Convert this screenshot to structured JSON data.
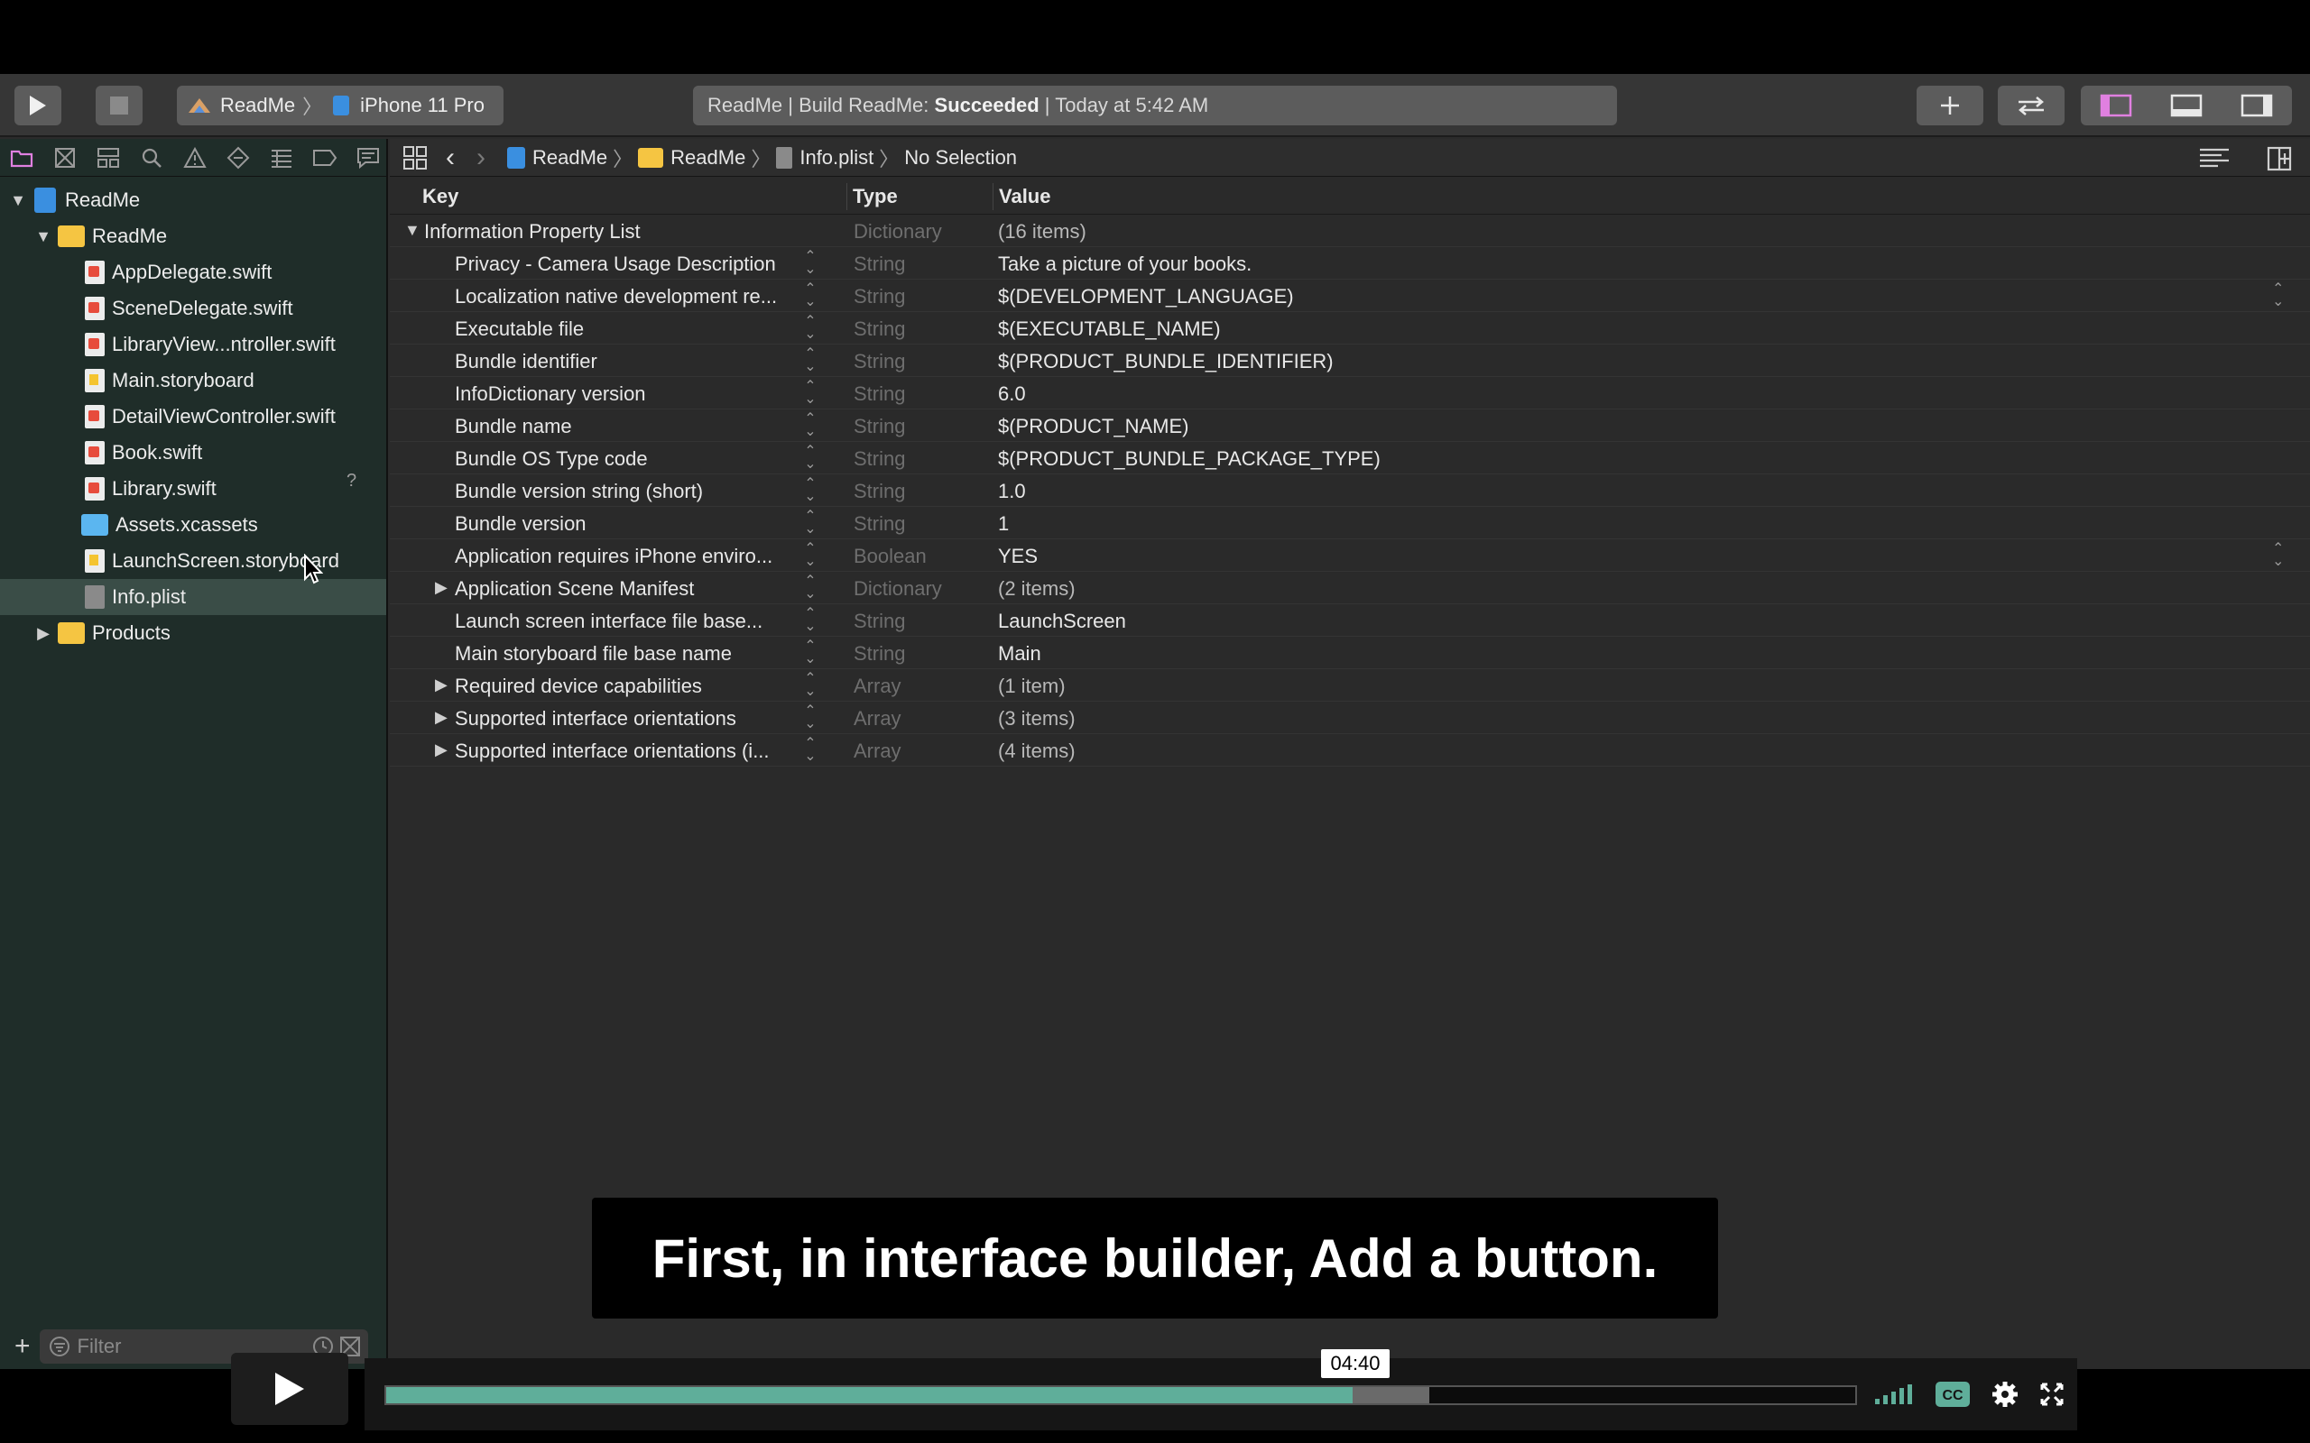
{
  "toolbar": {
    "scheme_project": "ReadMe",
    "scheme_device": "iPhone 11 Pro",
    "activity_prefix": "ReadMe | Build ReadMe: ",
    "activity_status": "Succeeded",
    "activity_suffix": " | Today at 5:42 AM"
  },
  "navigator": {
    "project": "ReadMe",
    "group": "ReadMe",
    "files": [
      {
        "name": "AppDelegate.swift",
        "kind": "swift"
      },
      {
        "name": "SceneDelegate.swift",
        "kind": "swift"
      },
      {
        "name": "LibraryView...ntroller.swift",
        "kind": "swift"
      },
      {
        "name": "Main.storyboard",
        "kind": "storyboard"
      },
      {
        "name": "DetailViewController.swift",
        "kind": "swift"
      },
      {
        "name": "Book.swift",
        "kind": "swift"
      },
      {
        "name": "Library.swift",
        "kind": "swift"
      },
      {
        "name": "Assets.xcassets",
        "kind": "assets"
      },
      {
        "name": "LaunchScreen.storyboard",
        "kind": "storyboard"
      },
      {
        "name": "Info.plist",
        "kind": "plist"
      }
    ],
    "products": "Products",
    "help_mark": "?",
    "filter_placeholder": "Filter"
  },
  "jumpbar": {
    "crumb1": "ReadMe",
    "crumb2": "ReadMe",
    "crumb3": "Info.plist",
    "crumb4": "No Selection"
  },
  "plist": {
    "headers": {
      "key": "Key",
      "type": "Type",
      "value": "Value"
    },
    "root": {
      "key": "Information Property List",
      "type": "Dictionary",
      "value": "(16 items)"
    },
    "rows": [
      {
        "key": "Privacy - Camera Usage Description",
        "type": "String",
        "value": "Take a picture of your books."
      },
      {
        "key": "Localization native development re...",
        "type": "String",
        "value": "$(DEVELOPMENT_LANGUAGE)"
      },
      {
        "key": "Executable file",
        "type": "String",
        "value": "$(EXECUTABLE_NAME)"
      },
      {
        "key": "Bundle identifier",
        "type": "String",
        "value": "$(PRODUCT_BUNDLE_IDENTIFIER)"
      },
      {
        "key": "InfoDictionary version",
        "type": "String",
        "value": "6.0"
      },
      {
        "key": "Bundle name",
        "type": "String",
        "value": "$(PRODUCT_NAME)"
      },
      {
        "key": "Bundle OS Type code",
        "type": "String",
        "value": "$(PRODUCT_BUNDLE_PACKAGE_TYPE)"
      },
      {
        "key": "Bundle version string (short)",
        "type": "String",
        "value": "1.0"
      },
      {
        "key": "Bundle version",
        "type": "String",
        "value": "1"
      },
      {
        "key": "Application requires iPhone enviro...",
        "type": "Boolean",
        "value": "YES"
      },
      {
        "key": "Application Scene Manifest",
        "type": "Dictionary",
        "value": "(2 items)"
      },
      {
        "key": "Launch screen interface file base...",
        "type": "String",
        "value": "LaunchScreen"
      },
      {
        "key": "Main storyboard file base name",
        "type": "String",
        "value": "Main"
      },
      {
        "key": "Required device capabilities",
        "type": "Array",
        "value": "(1 item)"
      },
      {
        "key": "Supported interface orientations",
        "type": "Array",
        "value": "(3 items)"
      },
      {
        "key": "Supported interface orientations (i...",
        "type": "Array",
        "value": "(4 items)"
      }
    ]
  },
  "caption": "First, in interface builder, Add a button.",
  "player": {
    "time": "04:40",
    "progress": 0.658,
    "buffered": 0.71,
    "accent": "#5fae9a"
  }
}
